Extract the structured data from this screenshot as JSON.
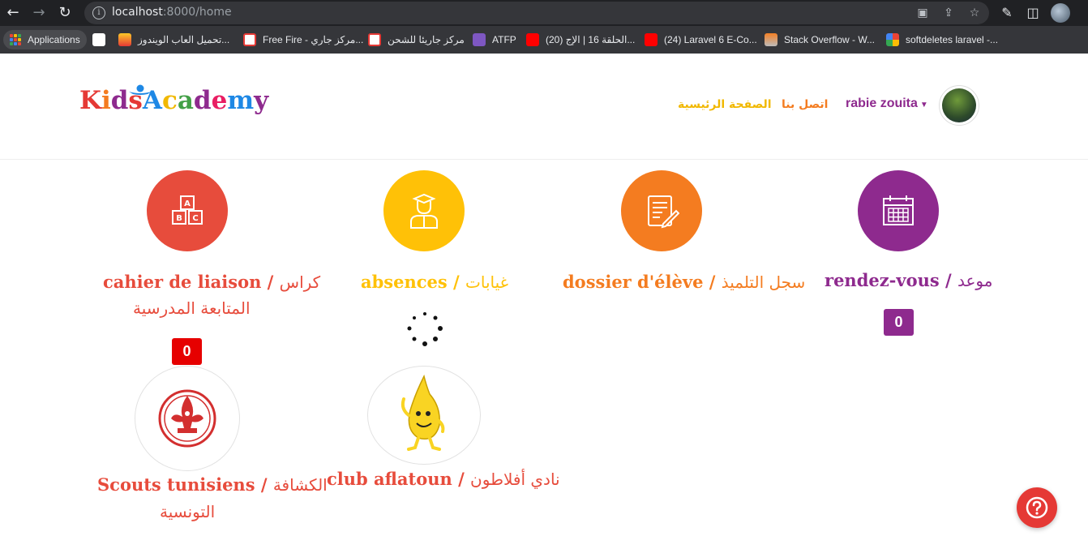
{
  "browser": {
    "url_host": "localhost",
    "url_rest": ":8000/home",
    "bookmarks": [
      {
        "label": "Applications",
        "icon": "apps-grid-icon"
      },
      {
        "label": "",
        "icon": "github-icon"
      },
      {
        "label": "تحميل العاب الويندوز...",
        "icon": "game-site-icon"
      },
      {
        "label": "Free Fire - مركز جاري...",
        "icon": "freefire-icon"
      },
      {
        "label": "مركز جاريئا للشحن",
        "icon": "freefire-icon"
      },
      {
        "label": "ATFP",
        "icon": "atfp-icon"
      },
      {
        "label": "(20) الحلقة 16 | الإج...",
        "icon": "youtube-icon"
      },
      {
        "label": "(24) Laravel 6 E-Co...",
        "icon": "youtube-icon"
      },
      {
        "label": "Stack Overflow - W...",
        "icon": "stackoverflow-icon"
      },
      {
        "label": "softdeletes laravel -...",
        "icon": "google-icon"
      }
    ]
  },
  "header": {
    "logo_letters": [
      "K",
      "i",
      "d",
      "s",
      "A",
      "c",
      "a",
      "d",
      "e",
      "m",
      "y"
    ],
    "logo_colors": [
      "#e53935",
      "#f47c20",
      "#8e2a8e",
      "#e53935",
      "#1e88e5",
      "#f1b800",
      "#43a047",
      "#8e2a8e",
      "#e91e63",
      "#1e88e5",
      "#8e2a8e"
    ],
    "nav_home": "الصفحة الرئيسية",
    "nav_contact": "اتصل بنا",
    "user_name": "rabie zouita"
  },
  "cards": {
    "liaison": {
      "title_latin": "cahier de liaison /",
      "title_arabic": "كراس",
      "subtitle": "المتابعة المدرسية",
      "badge": "0",
      "color": "#e74c3c"
    },
    "absences": {
      "title_latin": "absences /",
      "title_arabic": "غيابات",
      "color": "#ffc107"
    },
    "dossier": {
      "title_latin": "dossier d'élève /",
      "title_arabic": "سجل التلميذ",
      "color": "#f47c20"
    },
    "rdv": {
      "title_latin": "rendez-vous /",
      "title_arabic": "موعد",
      "badge": "0",
      "color": "#8e2a8e"
    },
    "scouts": {
      "title_latin": "Scouts tunisiens /",
      "title_arabic": "الكشافة",
      "subtitle": "التونسية",
      "color": "#e74c3c"
    },
    "aflatoun": {
      "title_latin": "club aflatoun /",
      "title_arabic": "نادي أفلاطون",
      "color": "#e74c3c"
    }
  },
  "colors": {
    "badge_red": "#e60000",
    "badge_purple": "#8e2a8e",
    "help_red": "#e53935"
  }
}
